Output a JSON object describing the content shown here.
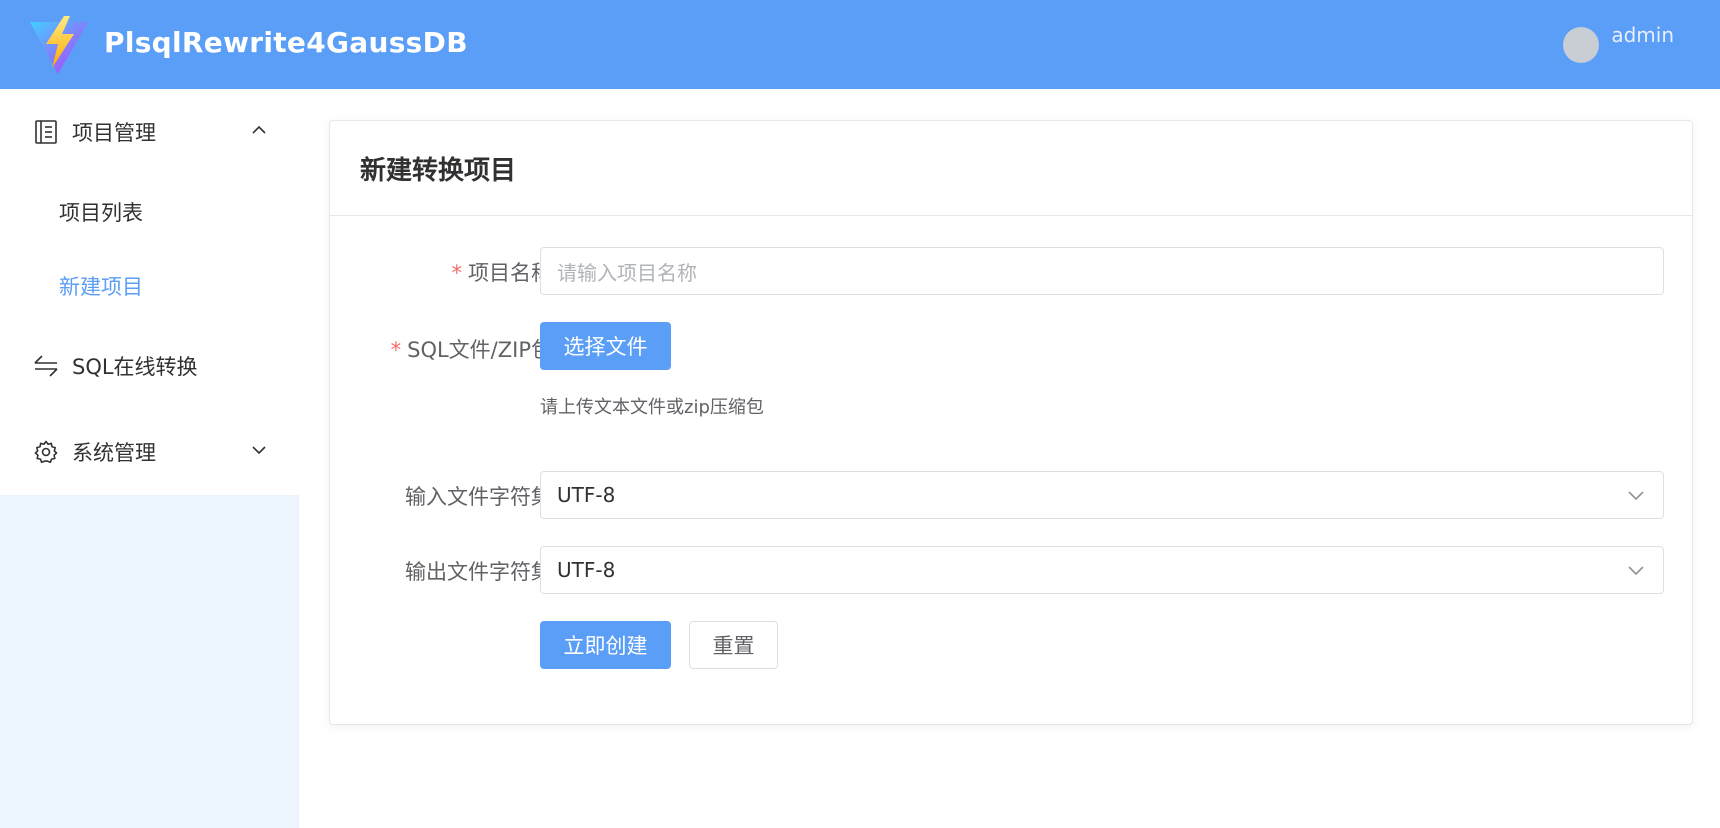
{
  "header": {
    "app_title": "PlsqlRewrite4GaussDB",
    "username": "admin"
  },
  "sidebar": {
    "items": [
      {
        "label": "项目管理",
        "icon": "document-list-icon",
        "expanded": true
      },
      {
        "label": "SQL在线转换",
        "icon": "swap-arrows-icon"
      },
      {
        "label": "系统管理",
        "icon": "gear-icon",
        "expanded": false
      }
    ],
    "sub_items": [
      {
        "label": "项目列表",
        "active": false
      },
      {
        "label": "新建项目",
        "active": true
      }
    ]
  },
  "card": {
    "title": "新建转换项目"
  },
  "form": {
    "project_name_label": "项目名称",
    "project_name_placeholder": "请输入项目名称",
    "file_label": "SQL文件/ZIP包",
    "file_button": "选择文件",
    "file_hint": "请上传文本文件或zip压缩包",
    "input_charset_label": "输入文件字符集",
    "input_charset_value": "UTF-8",
    "output_charset_label": "输出文件字符集",
    "output_charset_value": "UTF-8",
    "create_button": "立即创建",
    "reset_button": "重置",
    "required_mark": "*"
  },
  "colors": {
    "primary": "#5b9ef7",
    "required": "#f56c6c",
    "sidebar_bg": "#ecf4fe"
  }
}
